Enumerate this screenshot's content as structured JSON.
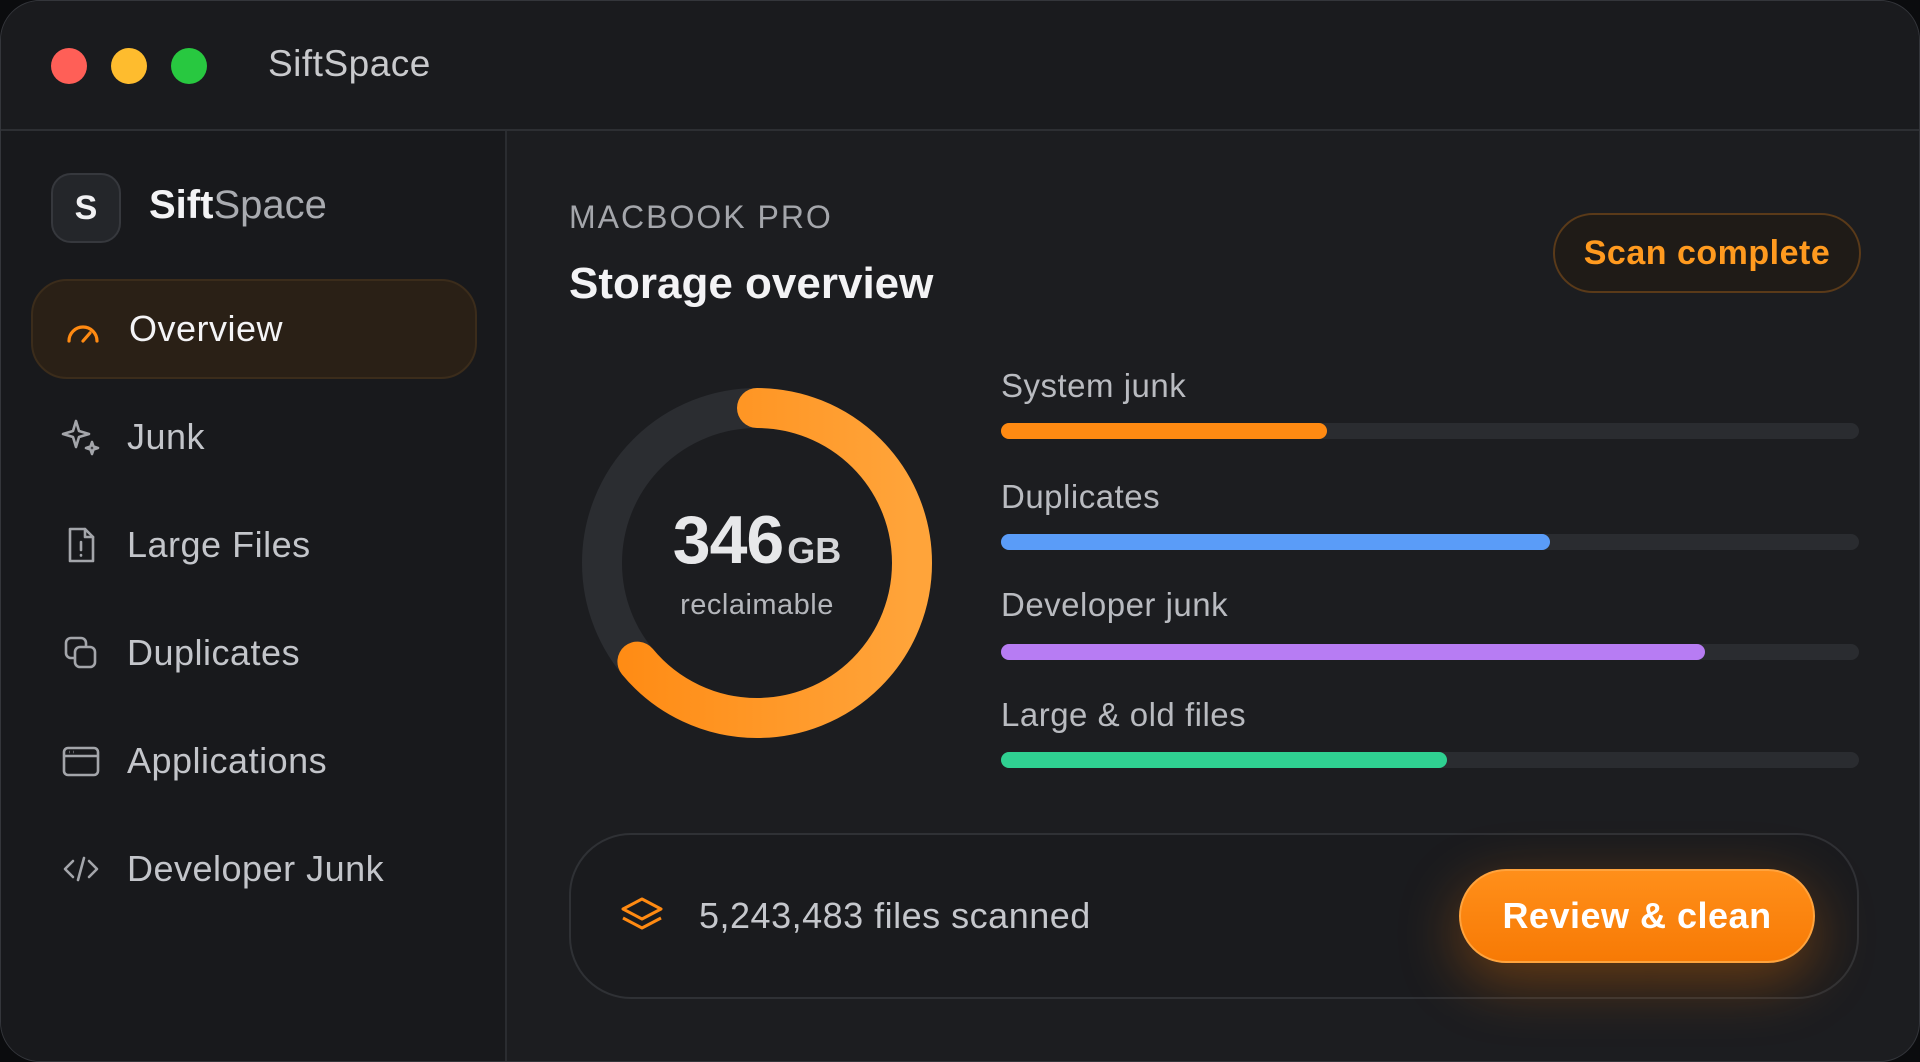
{
  "window": {
    "title": "SiftSpace",
    "traffic_lights": {
      "close": "#ff5f57",
      "minimize": "#febc2e",
      "zoom": "#28c840"
    }
  },
  "sidebar": {
    "brand": {
      "badge": "S",
      "name_bold": "Sift",
      "name_light": "Space"
    },
    "items": [
      {
        "label": "Overview",
        "icon": "gauge-icon",
        "active": true
      },
      {
        "label": "Junk",
        "icon": "sparkles-icon",
        "active": false
      },
      {
        "label": "Large Files",
        "icon": "file-alert-icon",
        "active": false
      },
      {
        "label": "Duplicates",
        "icon": "copy-icon",
        "active": false
      },
      {
        "label": "Applications",
        "icon": "app-window-icon",
        "active": false
      },
      {
        "label": "Developer Junk",
        "icon": "code-icon",
        "active": false
      }
    ]
  },
  "main": {
    "device_label": "MACBOOK PRO",
    "title": "Storage overview",
    "status": "Scan complete",
    "reclaimable": {
      "value": "346",
      "unit": "GB",
      "label": "reclaimable",
      "ring_fraction": 0.64
    },
    "categories": [
      {
        "label": "System junk",
        "fraction": 0.38,
        "color": "#ff8a12"
      },
      {
        "label": "Duplicates",
        "fraction": 0.64,
        "color": "#5a9cf8"
      },
      {
        "label": "Developer junk",
        "fraction": 0.82,
        "color": "#b77cf3"
      },
      {
        "label": "Large & old files",
        "fraction": 0.52,
        "color": "#2fd091"
      }
    ],
    "footer": {
      "icon": "layers-icon",
      "files_scanned": "5,243,483 files scanned",
      "action": "Review & clean"
    }
  },
  "colors": {
    "accent": "#ff8a12",
    "background": "#1c1d20",
    "sidebar": "#18191c"
  }
}
